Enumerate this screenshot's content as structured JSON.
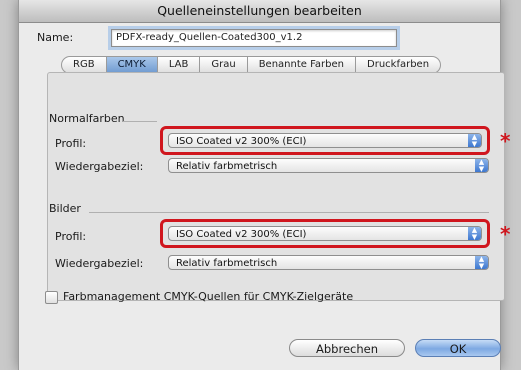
{
  "window": {
    "title": "Quelleneinstellungen bearbeiten"
  },
  "name": {
    "label": "Name:",
    "value": "PDFX-ready_Quellen-Coated300_v1.2"
  },
  "tabs": [
    {
      "label": "RGB",
      "active": false
    },
    {
      "label": "CMYK",
      "active": true
    },
    {
      "label": "LAB",
      "active": false
    },
    {
      "label": "Grau",
      "active": false
    },
    {
      "label": "Benannte Farben",
      "active": false
    },
    {
      "label": "Druckfarben",
      "active": false
    }
  ],
  "normalfarben": {
    "heading": "Normalfarben",
    "profil_label": "Profil:",
    "profil_value": "ISO Coated v2 300% (ECI)",
    "wiedergabe_label": "Wiedergabeziel:",
    "wiedergabe_value": "Relativ farbmetrisch"
  },
  "bilder": {
    "heading": "Bilder",
    "profil_label": "Profil:",
    "profil_value": "ISO Coated v2 300% (ECI)",
    "wiedergabe_label": "Wiedergabeziel:",
    "wiedergabe_value": "Relativ farbmetrisch"
  },
  "annotation": {
    "marker": "*",
    "color": "#d0161e"
  },
  "checkbox": {
    "label": "Farbmanagement CMYK-Quellen für CMYK-Zielgeräte",
    "checked": false
  },
  "buttons": {
    "cancel": "Abbrechen",
    "ok": "OK"
  },
  "icons": {
    "popup": "updown-stepper-icon"
  }
}
